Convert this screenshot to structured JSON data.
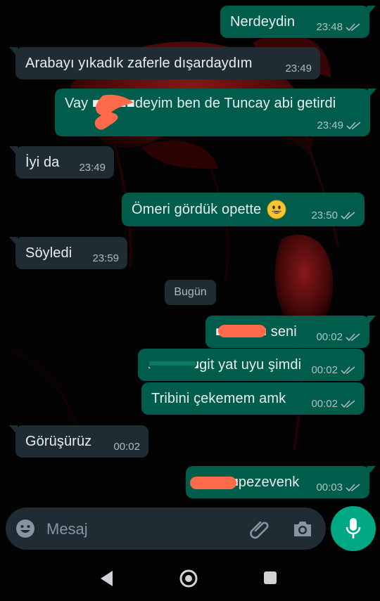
{
  "messages": [
    {
      "dir": "out",
      "text": "Nerdeydin",
      "time": "23:48"
    },
    {
      "dir": "in",
      "text": "Arabayı yıkadık zaferle dışardaydım",
      "time": "23:49"
    },
    {
      "dir": "out",
      "text": "Vay ■■■■■deyim ben de Tuncay abi getirdi",
      "time": "23:49"
    },
    {
      "dir": "in",
      "text": "İyi da",
      "time": "23:49"
    },
    {
      "dir": "out",
      "text": "Ömeri gördük opette",
      "time": "23:50"
    },
    {
      "dir": "in",
      "text": "Söyledi",
      "time": "23:59"
    },
    {
      "dir": "out",
      "text": "■■■■■■ seni",
      "time": "00:02"
    },
    {
      "dir": "out",
      "text": "■■■■■■git yat uyu şimdi",
      "time": "00:02"
    },
    {
      "dir": "out",
      "text": "Tribini çekemem amk",
      "time": "00:02"
    },
    {
      "dir": "in",
      "text": "Görüşürüz",
      "time": "00:02"
    },
    {
      "dir": "out",
      "text": "■■■■■pezevenk",
      "time": "00:03"
    }
  ],
  "date_divider": "Bugün",
  "composer": {
    "placeholder": "Mesaj",
    "emoji_icon": "emoji-icon",
    "attach_icon": "paperclip-icon",
    "camera_icon": "camera-icon",
    "mic_icon": "microphone-icon"
  },
  "navbar": {
    "back_icon": "back-triangle-icon",
    "home_icon": "home-circle-icon",
    "recents_icon": "recents-square-icon"
  },
  "colors": {
    "incoming_bubble": "#1f2c34",
    "outgoing_bubble": "#005c4b",
    "accent": "#00a884",
    "redaction": "#ff6b4a"
  }
}
